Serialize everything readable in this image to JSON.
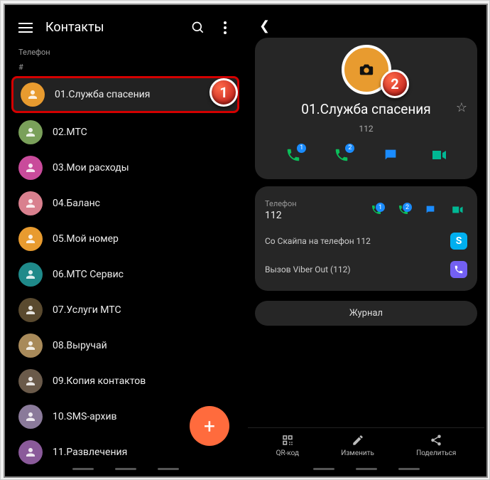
{
  "left": {
    "title": "Контакты",
    "section": "Телефон",
    "hash": "#",
    "contacts": [
      {
        "name": "01.Служба спасения",
        "color": "#e89b2f",
        "highlighted": true
      },
      {
        "name": "02.МТС",
        "color": "#7aa05a"
      },
      {
        "name": "03.Мои расходы",
        "color": "#c94b9b"
      },
      {
        "name": "04.Баланс",
        "color": "#d9808e"
      },
      {
        "name": "05.Мой номер",
        "color": "#e89b2f"
      },
      {
        "name": "06.МТС Сервис",
        "color": "#1f8a8a"
      },
      {
        "name": "07.Услуги МТС",
        "color": "#5a4a2f"
      },
      {
        "name": "08.Выручай",
        "color": "#a88a5a"
      },
      {
        "name": "09.Копия контактов",
        "color": "#6a5a4a"
      },
      {
        "name": "10.SMS-архив",
        "color": "#8a7a9a"
      },
      {
        "name": "11.Развлечения",
        "color": "#8a5a9a"
      }
    ],
    "step": "1"
  },
  "right": {
    "step": "2",
    "profile_name": "01.Служба спасения",
    "profile_number": "112",
    "phone_label": "Телефон",
    "phone_value": "112",
    "skype_text": "Со Скайпа на телефон 112",
    "viber_text": "Вызов Viber Out (112)",
    "log_button": "Журнал",
    "bottom": {
      "qr": "QR-код",
      "edit": "Изменить",
      "share": "Поделиться"
    },
    "badges": {
      "sim1": "1",
      "sim2": "2"
    }
  }
}
